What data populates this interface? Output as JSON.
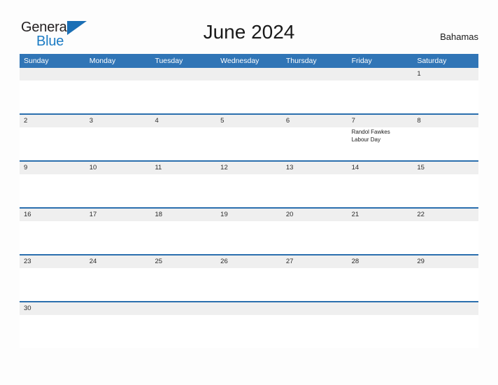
{
  "logo": {
    "word_one": "General",
    "word_two": "Blue",
    "flag_icon": "triangle-flag-icon",
    "color_dark": "#231f20",
    "color_blue": "#1b7bc4"
  },
  "header": {
    "title": "June 2024",
    "country": "Bahamas"
  },
  "theme": {
    "header_blue": "#3075b6",
    "rule_blue": "#2b6fae",
    "date_band_gray": "#efefef",
    "page_background": "#fdfdfd"
  },
  "calendar": {
    "month": "June",
    "year": "2024",
    "weekdays": [
      "Sunday",
      "Monday",
      "Tuesday",
      "Wednesday",
      "Thursday",
      "Friday",
      "Saturday"
    ],
    "weeks": [
      {
        "days": [
          {
            "date": "",
            "events": []
          },
          {
            "date": "",
            "events": []
          },
          {
            "date": "",
            "events": []
          },
          {
            "date": "",
            "events": []
          },
          {
            "date": "",
            "events": []
          },
          {
            "date": "",
            "events": []
          },
          {
            "date": "1",
            "events": []
          }
        ]
      },
      {
        "days": [
          {
            "date": "2",
            "events": []
          },
          {
            "date": "3",
            "events": []
          },
          {
            "date": "4",
            "events": []
          },
          {
            "date": "5",
            "events": []
          },
          {
            "date": "6",
            "events": []
          },
          {
            "date": "7",
            "events": [
              "Randol Fawkes",
              "Labour Day"
            ]
          },
          {
            "date": "8",
            "events": []
          }
        ]
      },
      {
        "days": [
          {
            "date": "9",
            "events": []
          },
          {
            "date": "10",
            "events": []
          },
          {
            "date": "11",
            "events": []
          },
          {
            "date": "12",
            "events": []
          },
          {
            "date": "13",
            "events": []
          },
          {
            "date": "14",
            "events": []
          },
          {
            "date": "15",
            "events": []
          }
        ]
      },
      {
        "days": [
          {
            "date": "16",
            "events": []
          },
          {
            "date": "17",
            "events": []
          },
          {
            "date": "18",
            "events": []
          },
          {
            "date": "19",
            "events": []
          },
          {
            "date": "20",
            "events": []
          },
          {
            "date": "21",
            "events": []
          },
          {
            "date": "22",
            "events": []
          }
        ]
      },
      {
        "days": [
          {
            "date": "23",
            "events": []
          },
          {
            "date": "24",
            "events": []
          },
          {
            "date": "25",
            "events": []
          },
          {
            "date": "26",
            "events": []
          },
          {
            "date": "27",
            "events": []
          },
          {
            "date": "28",
            "events": []
          },
          {
            "date": "29",
            "events": []
          }
        ]
      },
      {
        "days": [
          {
            "date": "30",
            "events": []
          },
          {
            "date": "",
            "events": []
          },
          {
            "date": "",
            "events": []
          },
          {
            "date": "",
            "events": []
          },
          {
            "date": "",
            "events": []
          },
          {
            "date": "",
            "events": []
          },
          {
            "date": "",
            "events": []
          }
        ]
      }
    ]
  }
}
